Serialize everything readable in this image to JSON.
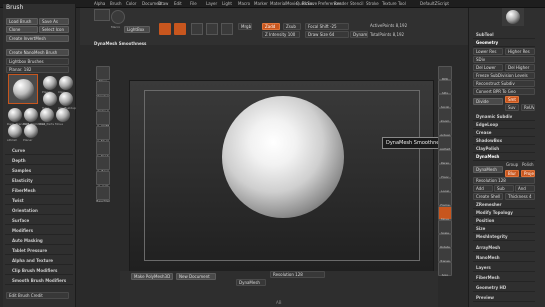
{
  "menu": [
    "Alpha",
    "Brush",
    "Color",
    "Document",
    "Draw",
    "Edit",
    "File",
    "Layer",
    "Light",
    "Macro",
    "Marker",
    "Material",
    "Movie",
    "Picker",
    "Preferences",
    "Render",
    "Stencil",
    "Stroke",
    "Texture",
    "Tool"
  ],
  "menu_right": "QuickSave",
  "menu_right2": "DefaultZScript",
  "brush_panel": {
    "title": "Brush",
    "load": "Load Brush",
    "save": "Save As",
    "clone": "Clone",
    "select_icon": "Select Icon",
    "create_inv": "Create InvertMesh",
    "create_nano": "Create NanoMesh Brush",
    "lightbox": "Lightbox Brushes",
    "brush_name": "Planar. 182",
    "thumbs": [
      {
        "label": "Planar"
      },
      {
        "label": "Clay"
      },
      {
        "label": "Tube"
      },
      {
        "label": "ClayBuildup"
      },
      {
        "label": "Dam_Standard"
      },
      {
        "label": "IMM_Primitives"
      },
      {
        "label": "IMM_Parts"
      },
      {
        "label": "Move"
      },
      {
        "label": "sPolish"
      },
      {
        "label": "Planar"
      }
    ],
    "sections": [
      "Curve",
      "Depth",
      "Samples",
      "Elasticity",
      "FiberMesh",
      "Twist",
      "Orientation",
      "Surface",
      "Modifiers",
      "Auto Masking",
      "Tablet Pressure",
      "Alpha and Texture",
      "Clip Brush Modifiers",
      "Smooth Brush Modifiers"
    ],
    "edit_credit": "Edit Brush Credit"
  },
  "toolbar": {
    "menu_lbl": "Menu",
    "macro": "Macro",
    "lightbox": "LightBox",
    "zadd": "Zadd",
    "zsub": "Zsub",
    "rgb_intensity": "Z Intensity 100",
    "draw_size": "Draw Size 64",
    "focal_shift": "Focal Shift -25",
    "dynamic": "Dynamic",
    "active_points": "ActivePoints 8,192",
    "total_points": "TotalPoints 8,192",
    "mrgb": "Mrgb",
    "rgb": "Rgb",
    "m": "M",
    "edit": "Edit",
    "draw": "Draw",
    "move": "Move",
    "scale": "Scale",
    "rotate": "Rotate"
  },
  "canvas_title": "DynaMesh Smoothness",
  "left_tools": [
    {
      "label": "Move"
    },
    {
      "label": "Standard"
    },
    {
      "label": "Alpha 2"
    },
    {
      "label": "sL_NoBF"
    },
    {
      "label": "sL_FX_CL"
    },
    {
      "label": "sL_Ready"
    },
    {
      "label": "sL_Basic"
    },
    {
      "label": "sL_GrO"
    },
    {
      "label": "BasicMat"
    }
  ],
  "tooltip": "DynaMesh Smoothness",
  "right_tools": [
    {
      "label": "BPR"
    },
    {
      "label": "SPix"
    },
    {
      "label": "Scroll"
    },
    {
      "label": "Zoom"
    },
    {
      "label": "Actual"
    },
    {
      "label": "AAHalf"
    },
    {
      "label": "Persp"
    },
    {
      "label": "Floor"
    },
    {
      "label": "Local"
    },
    {
      "label": "Frame"
    },
    {
      "label": "Move"
    },
    {
      "label": "Scale"
    },
    {
      "label": "Rotate"
    },
    {
      "label": "Transp"
    },
    {
      "label": "Solo"
    }
  ],
  "bottom": {
    "make": "Make PolyMesh3D",
    "new_doc": "New Document",
    "dynamesh": "DynaMesh",
    "resolution": "Resolution 128",
    "ab": "AB"
  },
  "subtool": {
    "title": "SubTool",
    "geometry": "Geometry",
    "lower_res": "Lower Res",
    "higher_res": "Higher Res",
    "sdiv": "SDiv",
    "del_lower": "Del Lower",
    "del_higher": "Del Higher",
    "freeze": "Freeze SubDivision Levels",
    "reconstruct": "Reconstruct Subdiv",
    "convert": "Convert BPR To Geo",
    "divide": "Divide",
    "smt": "Smt",
    "suv": "Suv",
    "reuv": "ReUV",
    "dynamic_subdiv": "Dynamic Subdiv",
    "edgeloop": "EdgeLoop",
    "crease": "Crease",
    "shadowbox": "ShadowBox",
    "claypolish": "ClayPolish",
    "dynamesh": "DynaMesh",
    "group": "Group",
    "polish": "Polish",
    "dynamesh_btn": "DynaMesh",
    "blur": "Blur",
    "project": "Project",
    "resolution": "Resolution 128",
    "add": "Add",
    "sub": "Sub",
    "and": "And",
    "create_shell": "Create Shell",
    "thickness": "Thickness 4",
    "zremesher": "ZRemesher",
    "modify_topology": "Modify Topology",
    "position": "Position",
    "size": "Size",
    "meshintegrity": "MeshIntegrity"
  },
  "right_sections": [
    "ArrayMesh",
    "NanoMesh",
    "Layers",
    "FiberMesh",
    "Geometry HD",
    "Preview"
  ]
}
